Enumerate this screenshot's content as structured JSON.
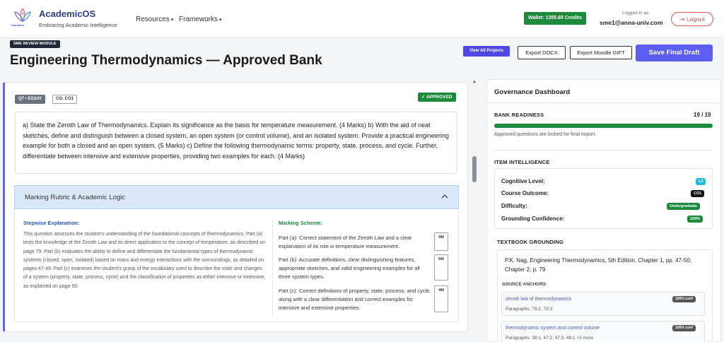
{
  "header": {
    "logo_sub": "Yumedine",
    "brand_name": "AcademicOS",
    "brand_tagline": "Embracing Academic Intelligence",
    "nav": [
      {
        "label": "Resources"
      },
      {
        "label": "Frameworks"
      }
    ],
    "wallet": "Wallet: 1355.65 Credits",
    "logged_in_label": "Logged in as",
    "user_email": "sme1@anna-univ.com",
    "logout_label": "Logout"
  },
  "title_row": {
    "module_badge": "SME REVIEW MODULE",
    "page_title": "Engineering Thermodynamics — Approved Bank",
    "view_all": "View All Projects",
    "export_docx": "Export DOCX",
    "export_gift": "Export Moodle GIFT",
    "save_final": "Save Final Draft"
  },
  "question": {
    "type_chip": "Q7 • ESSAY",
    "co_chip": "CO: CO1",
    "status": "✓ APPROVED",
    "text": "a) State the Zeroth Law of Thermodynamics. Explain its significance as the basis for temperature measurement. (4 Marks) b) With the aid of neat sketches, define and distinguish between a closed system, an open system (or control volume), and an isolated system. Provide a practical engineering example for both a closed and an open system. (5 Marks) c) Define the following thermodynamic terms: property, state, process, and cycle. Further, differentiate between intensive and extensive properties, providing two examples for each. (4 Marks)"
  },
  "rubric": {
    "title": "Marking Rubric & Academic Logic",
    "stepwise_heading": "Stepwise Explanation:",
    "stepwise_text": "This question assesses the student's understanding of the foundational concepts of thermodynamics. Part (a) tests the knowledge of the Zeroth Law and its direct application to the concept of temperature, as described on page 79. Part (b) evaluates the ability to define and differentiate the fundamental types of thermodynamic systems (closed, open, isolated) based on mass and energy interactions with the surroundings, as detailed on pages 47-49. Part (c) examines the student's grasp of the vocabulary used to describe the state and changes of a system (property, state, process, cycle) and the classification of properties as either intensive or extensive, as explained on page 50.",
    "scheme_heading": "Marking Scheme:",
    "scheme": [
      {
        "text": "Part (a): Correct statement of the Zeroth Law and a clear explanation of its role in temperature measurement.",
        "marks": "4M"
      },
      {
        "text": "Part (b): Accurate definitions, clear distinguishing features, appropriate sketches, and valid engineering examples for all three system types.",
        "marks": "5M"
      },
      {
        "text": "Part (c): Correct definitions of property, state, process, and cycle, along with a clear differentiation and correct examples for intensive and extensive properties.",
        "marks": "4M"
      }
    ]
  },
  "governance": {
    "title": "Governance Dashboard",
    "readiness_label": "BANK READINESS",
    "readiness_count": "19 / 19",
    "readiness_fraction": 1.0,
    "locked_note": "Approved questions are locked for final export.",
    "intel_label": "ITEM INTELLIGENCE",
    "intel": [
      {
        "label": "Cognitive Level:",
        "value": "L3",
        "color": "#22b8e6"
      },
      {
        "label": "Course Outcome:",
        "value": "CO1",
        "color": "#111111"
      },
      {
        "label": "Difficulty:",
        "value": "Undergraduate",
        "color": "#1c8a3b"
      },
      {
        "label": "Grounding Confidence:",
        "value": "100%",
        "color": "#1c8a3b"
      }
    ],
    "grounding_label": "TEXTBOOK GROUNDING",
    "citation": "P.K. Nag, Engineering Thermodynamics, 5th Edition, Chapter 1, pp. 47-50; Chapter 2, p. 79",
    "anchors_label": "SOURCE ANCHORS",
    "anchors": [
      {
        "title": "zeroth law of thermodynamics",
        "pages": "Paragraphs: 79:2, 79:3",
        "conf": "100% conf"
      },
      {
        "title": "thermodynamic system and control volume",
        "pages": "Paragraphs: 38:1, 47:2, 47:3, 48:1 +2 more",
        "conf": "100% conf"
      }
    ]
  },
  "colors": {
    "accent": "#5b5ef0",
    "approved_green": "#1c8a3b",
    "logout_red": "#d9534f"
  }
}
